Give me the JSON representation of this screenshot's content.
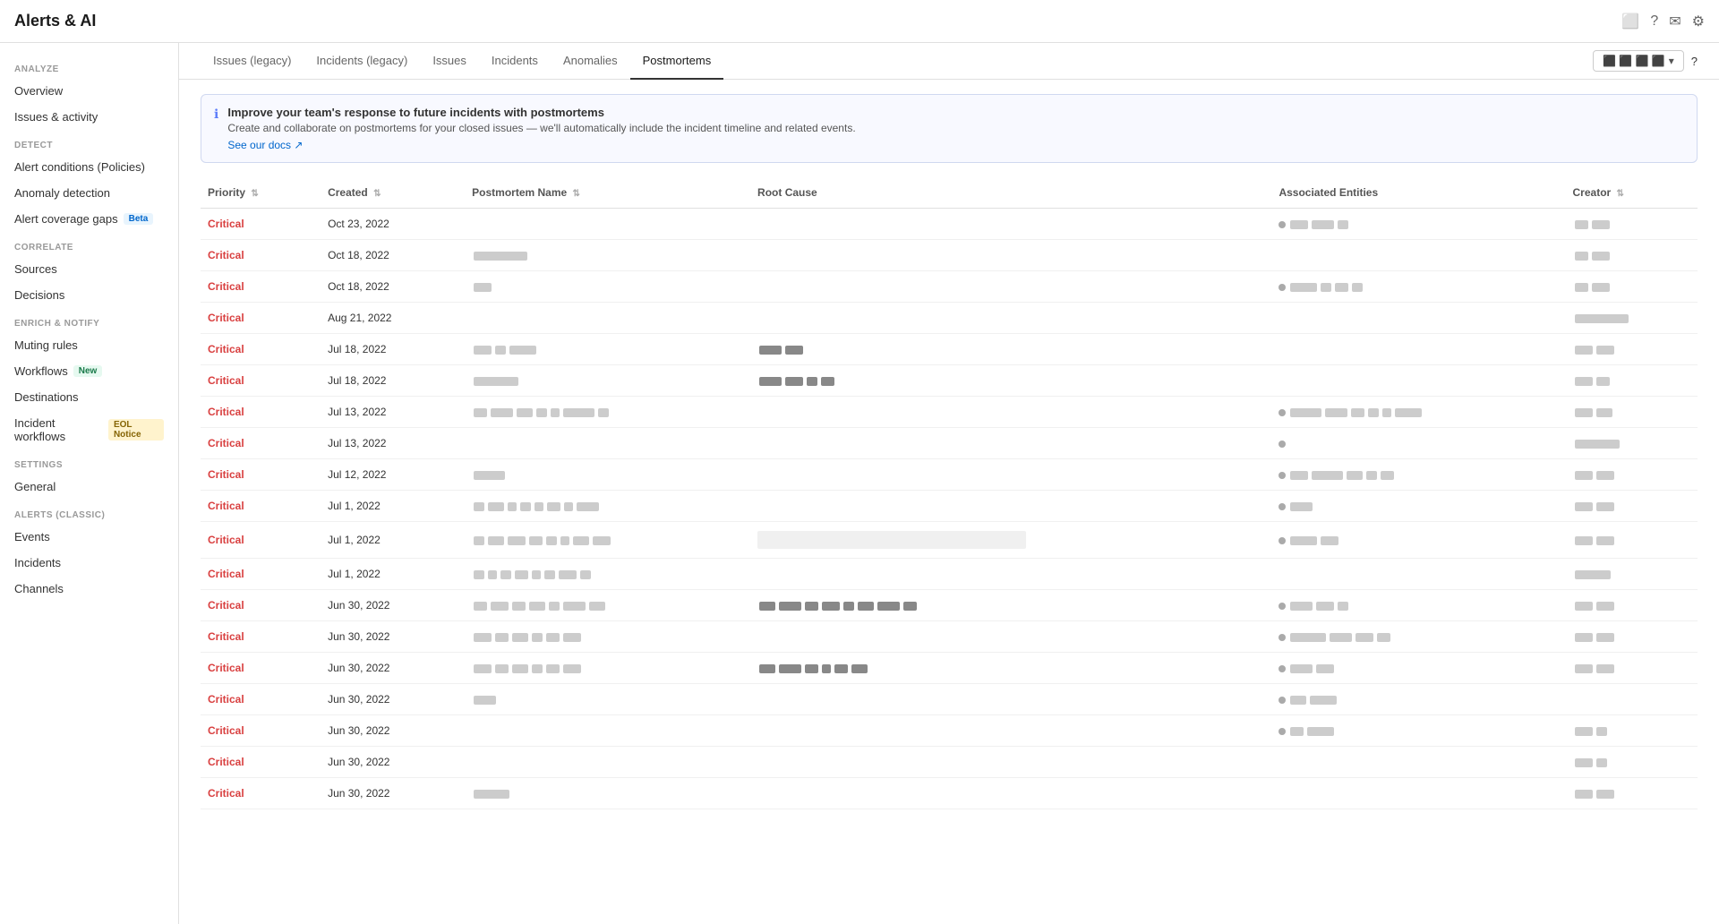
{
  "app": {
    "title": "Alerts & AI"
  },
  "sidebar": {
    "sections": [
      {
        "label": "ANALYZE",
        "items": [
          {
            "id": "overview",
            "label": "Overview",
            "badge": null
          },
          {
            "id": "issues-activity",
            "label": "Issues & activity",
            "badge": null
          }
        ]
      },
      {
        "label": "DETECT",
        "items": [
          {
            "id": "alert-conditions",
            "label": "Alert conditions (Policies)",
            "badge": null
          },
          {
            "id": "anomaly-detection",
            "label": "Anomaly detection",
            "badge": null
          },
          {
            "id": "alert-coverage-gaps",
            "label": "Alert coverage gaps",
            "badge": {
              "text": "Beta",
              "type": "blue"
            }
          }
        ]
      },
      {
        "label": "CORRELATE",
        "items": [
          {
            "id": "sources",
            "label": "Sources",
            "badge": null
          },
          {
            "id": "decisions",
            "label": "Decisions",
            "badge": null
          }
        ]
      },
      {
        "label": "ENRICH & NOTIFY",
        "items": [
          {
            "id": "muting-rules",
            "label": "Muting rules",
            "badge": null
          },
          {
            "id": "workflows",
            "label": "Workflows",
            "badge": {
              "text": "New",
              "type": "green"
            }
          },
          {
            "id": "destinations",
            "label": "Destinations",
            "badge": null
          },
          {
            "id": "incident-workflows",
            "label": "Incident workflows",
            "badge": {
              "text": "EOL Notice",
              "type": "yellow"
            }
          }
        ]
      },
      {
        "label": "SETTINGS",
        "items": [
          {
            "id": "general",
            "label": "General",
            "badge": null
          }
        ]
      },
      {
        "label": "ALERTS (CLASSIC)",
        "items": [
          {
            "id": "events",
            "label": "Events",
            "badge": null
          },
          {
            "id": "incidents-classic",
            "label": "Incidents",
            "badge": null
          },
          {
            "id": "channels",
            "label": "Channels",
            "badge": null
          }
        ]
      }
    ]
  },
  "tabs": {
    "items": [
      {
        "id": "issues-legacy",
        "label": "Issues (legacy)"
      },
      {
        "id": "incidents-legacy",
        "label": "Incidents (legacy)"
      },
      {
        "id": "issues",
        "label": "Issues"
      },
      {
        "id": "incidents",
        "label": "Incidents"
      },
      {
        "id": "anomalies",
        "label": "Anomalies"
      },
      {
        "id": "postmortems",
        "label": "Postmortems"
      }
    ],
    "active": "postmortems"
  },
  "banner": {
    "title": "Improve your team's response to future incidents with postmortems",
    "description": "Create and collaborate on postmortems for your closed issues — we'll automatically include the incident timeline and related events.",
    "link_text": "See our docs ↗"
  },
  "table": {
    "columns": [
      {
        "id": "priority",
        "label": "Priority"
      },
      {
        "id": "created",
        "label": "Created"
      },
      {
        "id": "postmortem-name",
        "label": "Postmortem Name"
      },
      {
        "id": "root-cause",
        "label": "Root Cause"
      },
      {
        "id": "associated-entities",
        "label": "Associated Entities"
      },
      {
        "id": "creator",
        "label": "Creator"
      }
    ],
    "rows": [
      {
        "priority": "Critical",
        "created": "Oct 23, 2022",
        "name_blocks": [],
        "root_cause_blocks": [],
        "entity_blocks": "dot-blocks",
        "creator_blocks": "sm"
      },
      {
        "priority": "Critical",
        "created": "Oct 18, 2022",
        "name_blocks": "single",
        "root_cause_blocks": [],
        "entity_blocks": "",
        "creator_blocks": "sm2"
      },
      {
        "priority": "Critical",
        "created": "Oct 18, 2022",
        "name_blocks": "tiny",
        "root_cause_blocks": [],
        "entity_blocks": "dot-blocks2",
        "creator_blocks": "sm3"
      },
      {
        "priority": "Critical",
        "created": "Aug 21, 2022",
        "name_blocks": [],
        "root_cause_blocks": [],
        "entity_blocks": "",
        "creator_blocks": "single"
      },
      {
        "priority": "Critical",
        "created": "Jul 18, 2022",
        "name_blocks": "multi",
        "root_cause_blocks": "pair",
        "entity_blocks": "",
        "creator_blocks": "pair"
      },
      {
        "priority": "Critical",
        "created": "Jul 18, 2022",
        "name_blocks": "single2",
        "root_cause_blocks": "triple",
        "entity_blocks": "",
        "creator_blocks": "pair2"
      },
      {
        "priority": "Critical",
        "created": "Jul 13, 2022",
        "name_blocks": "long",
        "root_cause_blocks": [],
        "entity_blocks": "dot-long",
        "creator_blocks": "pair3"
      },
      {
        "priority": "Critical",
        "created": "Jul 13, 2022",
        "name_blocks": [],
        "root_cause_blocks": [],
        "entity_blocks": "dot-single",
        "creator_blocks": "single2"
      },
      {
        "priority": "Critical",
        "created": "Jul 12, 2022",
        "name_blocks": "short",
        "root_cause_blocks": [],
        "entity_blocks": "dot-blocks3",
        "creator_blocks": "pair4"
      },
      {
        "priority": "Critical",
        "created": "Jul 1, 2022",
        "name_blocks": "varied",
        "root_cause_blocks": [],
        "entity_blocks": "dot-pair",
        "creator_blocks": "pair5"
      },
      {
        "priority": "Critical",
        "created": "Jul 1, 2022",
        "name_blocks": "varied2",
        "root_cause_blocks": "bg-bar",
        "entity_blocks": "dot-blocks4",
        "creator_blocks": "pair6"
      },
      {
        "priority": "Critical",
        "created": "Jul 1, 2022",
        "name_blocks": "varied3",
        "root_cause_blocks": [],
        "entity_blocks": "",
        "creator_blocks": "single3"
      },
      {
        "priority": "Critical",
        "created": "Jun 30, 2022",
        "name_blocks": "long2",
        "root_cause_blocks": "long",
        "entity_blocks": "dot-blocks5",
        "creator_blocks": "pair7"
      },
      {
        "priority": "Critical",
        "created": "Jun 30, 2022",
        "name_blocks": "long3",
        "root_cause_blocks": [],
        "entity_blocks": "dot-blocks6",
        "creator_blocks": "pair8"
      },
      {
        "priority": "Critical",
        "created": "Jun 30, 2022",
        "name_blocks": "long4",
        "root_cause_blocks": "long2",
        "entity_blocks": "dot-blocks7",
        "creator_blocks": "pair9"
      },
      {
        "priority": "Critical",
        "created": "Jun 30, 2022",
        "name_blocks": "tiny2",
        "root_cause_blocks": [],
        "entity_blocks": "dot-blocks8",
        "creator_blocks": "empty"
      },
      {
        "priority": "Critical",
        "created": "Jun 30, 2022",
        "name_blocks": [],
        "root_cause_blocks": [],
        "entity_blocks": "dot-pair2",
        "creator_blocks": "sm4"
      },
      {
        "priority": "Critical",
        "created": "Jun 30, 2022",
        "name_blocks": [],
        "root_cause_blocks": [],
        "entity_blocks": "",
        "creator_blocks": "sm5"
      },
      {
        "priority": "Critical",
        "created": "Jun 30, 2022",
        "name_blocks": "single3",
        "root_cause_blocks": [],
        "entity_blocks": "",
        "creator_blocks": "pair10"
      }
    ]
  },
  "filter_button": {
    "label": "▼"
  },
  "help_icon": "?",
  "colors": {
    "critical": "#d94040",
    "blue_accent": "#5c7cfa"
  }
}
